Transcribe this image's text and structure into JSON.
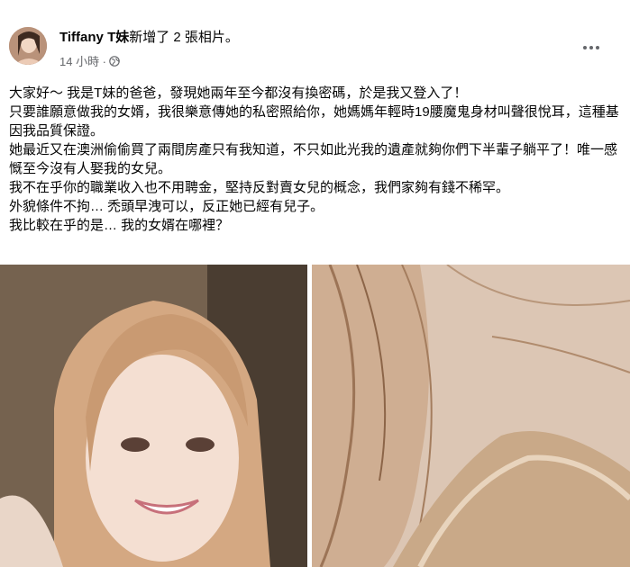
{
  "post": {
    "author_name": "Tiffany T妹",
    "action_text": "新增了 2 張相片。",
    "timestamp": "14 小時 ·",
    "privacy_icon": "globe-icon",
    "more_icon": "more-options-icon",
    "paragraphs": [
      "大家好～ 我是T妹的爸爸，發現她兩年至今都沒有換密碼，於是我又登入了！",
      "只要誰願意做我的女婿，我很樂意傳她的私密照給你，她媽媽年輕時19腰魔鬼身材叫聲很悅耳，這種基因我品質保證。",
      "她最近又在澳洲偷偷買了兩間房產只有我知道，不只如此光我的遺產就夠你們下半輩子躺平了！唯一感慨至今沒有人娶我的女兒。",
      "我不在乎你的職業收入也不用聘金，堅持反對賣女兒的概念，我們家夠有錢不稀罕。",
      "外貌條件不拘… 禿頭早洩可以，反正她已經有兒子。",
      "我比較在乎的是… 我的女婿在哪裡？"
    ],
    "photos": [
      "photo-selfie",
      "photo-closeup"
    ]
  }
}
